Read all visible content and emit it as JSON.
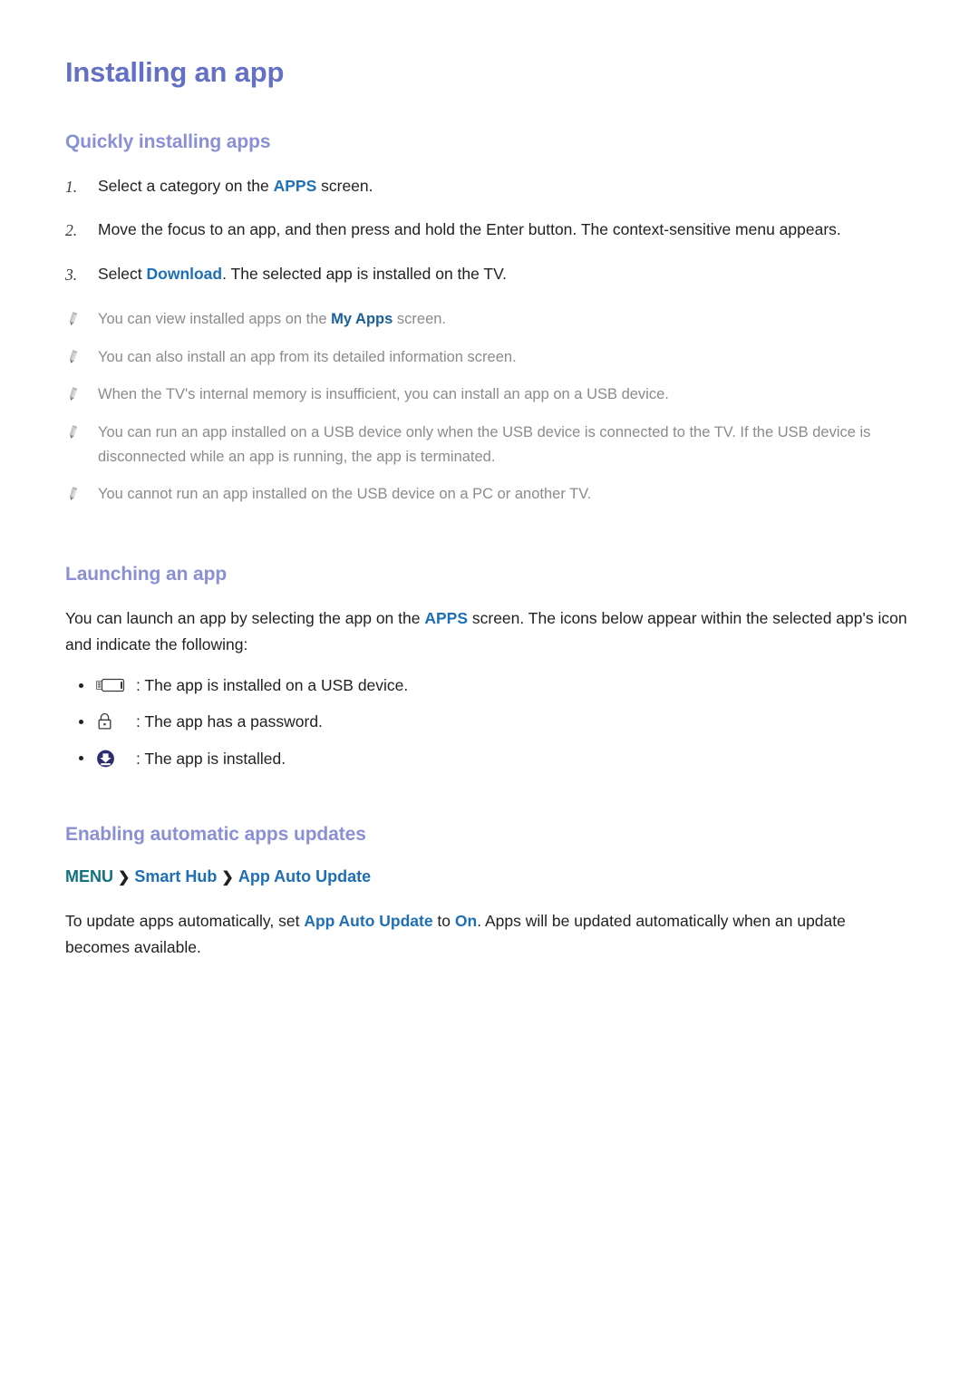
{
  "document": {
    "title": "Installing an app"
  },
  "section_quick": {
    "heading": "Quickly installing apps",
    "steps": [
      {
        "num": "1.",
        "pre": "Select a category on the ",
        "link": "APPS",
        "post": " screen."
      },
      {
        "num": "2.",
        "pre": "Move the focus to an app, and then press and hold the Enter button. The context-sensitive menu appears.",
        "link": "",
        "post": ""
      },
      {
        "num": "3.",
        "pre": "Select ",
        "link": "Download",
        "post": ". The selected app is installed on the TV."
      }
    ],
    "notes": [
      {
        "icon": "pencil-icon",
        "pre": "You can view installed apps on the ",
        "link": "My Apps",
        "post": " screen."
      },
      {
        "icon": "pencil-icon",
        "pre": "You can also install an app from its detailed information screen.",
        "link": "",
        "post": ""
      },
      {
        "icon": "pencil-icon",
        "pre": "When the TV's internal memory is insufficient, you can install an app on a USB device.",
        "link": "",
        "post": ""
      },
      {
        "icon": "pencil-icon",
        "pre": "You can run an app installed on a USB device only when the USB device is connected to the TV. If the USB device is disconnected while an app is running, the app is terminated.",
        "link": "",
        "post": ""
      },
      {
        "icon": "pencil-icon",
        "pre": "You cannot run an app installed on the USB device on a PC or another TV.",
        "link": "",
        "post": ""
      }
    ]
  },
  "section_launch": {
    "heading": "Launching an app",
    "intro_pre": "You can launch an app by selecting the app on the ",
    "intro_link": "APPS",
    "intro_post": " screen. The icons below appear within the selected app's icon and indicate the following:",
    "legend": [
      {
        "icon": "usb-stick-icon",
        "text": ": The app is installed on a USB device."
      },
      {
        "icon": "padlock-icon",
        "text": ": The app has a password."
      },
      {
        "icon": "download-badge-icon",
        "text": ": The app is installed."
      }
    ]
  },
  "section_update": {
    "heading": "Enabling automatic apps updates",
    "breadcrumb": {
      "menu": "MENU",
      "separator": "❯",
      "item1": "Smart Hub",
      "item2": "App Auto Update"
    },
    "paragraph": {
      "pre": "To update apps automatically, set ",
      "link1": "App Auto Update",
      "mid": " to ",
      "link2": "On",
      "post": ". Apps will be updated automatically when an update becomes available."
    }
  },
  "colors": {
    "title": "#6370c4",
    "section_heading": "#8a90d4",
    "link_blue": "#1d6fb8",
    "menu_teal": "#12707f",
    "body_text": "#231f20",
    "note_text": "#8b8b8e",
    "download_badge": "#2b2d6e"
  }
}
